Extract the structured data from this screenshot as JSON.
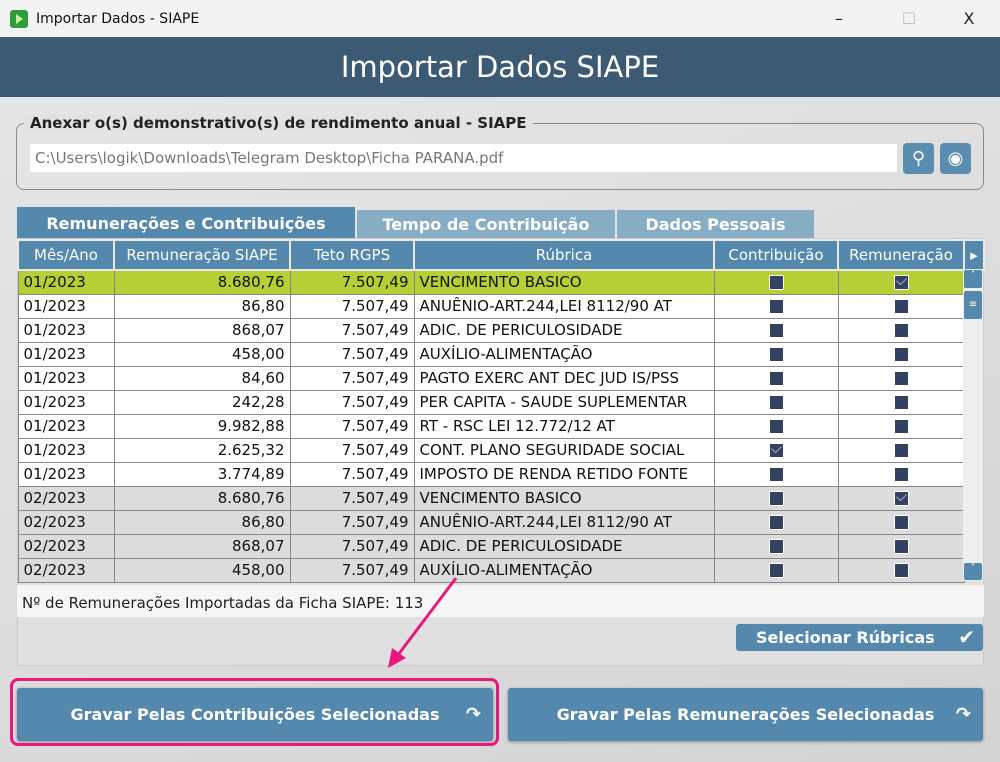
{
  "window": {
    "title": "Importar Dados - SIAPE",
    "minimize": "–",
    "maximize": "☐",
    "close": "X"
  },
  "header": {
    "title": "Importar Dados SIAPE"
  },
  "attach": {
    "label": "Anexar o(s) demonstrativo(s) de rendimento anual - SIAPE",
    "path": "C:\\Users\\logik\\Downloads\\Telegram Desktop\\Ficha PARANA.pdf",
    "search_icon": "search-icon",
    "view_icon": "eye-icon"
  },
  "tabs": [
    {
      "label": "Remunerações e Contribuições",
      "active": true
    },
    {
      "label": "Tempo de Contribuição"
    },
    {
      "label": "Dados Pessoais"
    }
  ],
  "table": {
    "columns": [
      "Mês/Ano",
      "Remuneração SIAPE",
      "Teto RGPS",
      "Rúbrica",
      "Contribuição",
      "Remuneração"
    ],
    "rows": [
      {
        "mes": "01/2023",
        "rem": "8.680,76",
        "teto": "7.507,49",
        "rub": "VENCIMENTO BASICO",
        "contrib": false,
        "remun": true
      },
      {
        "mes": "01/2023",
        "rem": "86,80",
        "teto": "7.507,49",
        "rub": "ANUÊNIO-ART.244,LEI 8112/90 AT",
        "contrib": false,
        "remun": false
      },
      {
        "mes": "01/2023",
        "rem": "868,07",
        "teto": "7.507,49",
        "rub": "ADIC. DE PERICULOSIDADE",
        "contrib": false,
        "remun": false
      },
      {
        "mes": "01/2023",
        "rem": "458,00",
        "teto": "7.507,49",
        "rub": "AUXÍLIO-ALIMENTAÇÃO",
        "contrib": false,
        "remun": false
      },
      {
        "mes": "01/2023",
        "rem": "84,60",
        "teto": "7.507,49",
        "rub": "PAGTO EXERC ANT DEC JUD IS/PSS",
        "contrib": false,
        "remun": false
      },
      {
        "mes": "01/2023",
        "rem": "242,28",
        "teto": "7.507,49",
        "rub": "PER CAPITA - SAUDE SUPLEMENTAR",
        "contrib": false,
        "remun": false
      },
      {
        "mes": "01/2023",
        "rem": "9.982,88",
        "teto": "7.507,49",
        "rub": "RT - RSC LEI 12.772/12 AT",
        "contrib": false,
        "remun": false
      },
      {
        "mes": "01/2023",
        "rem": "2.625,32",
        "teto": "7.507,49",
        "rub": "CONT. PLANO SEGURIDADE SOCIAL",
        "contrib": true,
        "remun": false
      },
      {
        "mes": "01/2023",
        "rem": "3.774,89",
        "teto": "7.507,49",
        "rub": "IMPOSTO DE RENDA RETIDO FONTE",
        "contrib": false,
        "remun": false
      },
      {
        "mes": "02/2023",
        "rem": "8.680,76",
        "teto": "7.507,49",
        "rub": "VENCIMENTO BASICO",
        "contrib": false,
        "remun": true
      },
      {
        "mes": "02/2023",
        "rem": "86,80",
        "teto": "7.507,49",
        "rub": "ANUÊNIO-ART.244,LEI 8112/90 AT",
        "contrib": false,
        "remun": false
      },
      {
        "mes": "02/2023",
        "rem": "868,07",
        "teto": "7.507,49",
        "rub": "ADIC. DE PERICULOSIDADE",
        "contrib": false,
        "remun": false
      },
      {
        "mes": "02/2023",
        "rem": "458,00",
        "teto": "7.507,49",
        "rub": "AUXÍLIO-ALIMENTAÇÃO",
        "contrib": false,
        "remun": false
      }
    ]
  },
  "status": {
    "text": "Nº de Remunerações Importadas da Ficha SIAPE: 113"
  },
  "buttons": {
    "select_rubricas": "Selecionar Rúbricas",
    "gravar_contrib": "Gravar Pelas Contribuições Selecionadas",
    "gravar_remun": "Gravar Pelas Remunerações Selecionadas"
  },
  "colors": {
    "header": "#3d5a75",
    "accent": "#5488ad",
    "selected_row": "#b5cf34",
    "highlight": "#e8197c"
  }
}
